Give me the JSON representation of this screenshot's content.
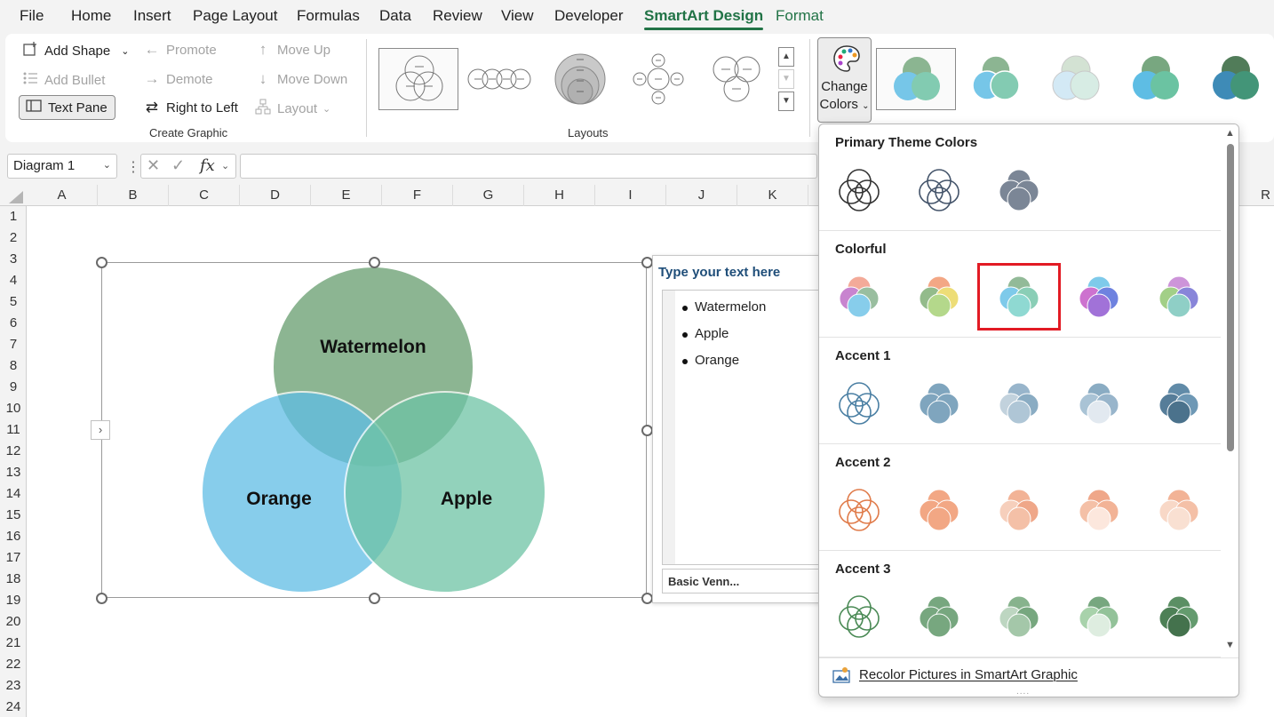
{
  "menu": [
    "File",
    "Home",
    "Insert",
    "Page Layout",
    "Formulas",
    "Data",
    "Review",
    "View",
    "Developer",
    "SmartArt Design",
    "Format"
  ],
  "create_graphic": {
    "add_shape": "Add Shape",
    "add_bullet": "Add Bullet",
    "text_pane": "Text Pane",
    "promote": "Promote",
    "demote": "Demote",
    "right_to_left": "Right to Left",
    "move_up": "Move Up",
    "move_down": "Move Down",
    "layout": "Layout",
    "group_label": "Create Graphic"
  },
  "layouts": {
    "group_label": "Layouts"
  },
  "change_colors": {
    "line1": "Change",
    "line2": "Colors"
  },
  "formula_bar": {
    "name_box": "Diagram 1",
    "fx": "fx",
    "formula": ""
  },
  "columns": [
    "A",
    "B",
    "C",
    "D",
    "E",
    "F",
    "G",
    "H",
    "I",
    "J",
    "K",
    "R"
  ],
  "rows": [
    "1",
    "2",
    "3",
    "4",
    "5",
    "6",
    "7",
    "8",
    "9",
    "10",
    "11",
    "12",
    "13",
    "14",
    "15",
    "16",
    "17",
    "18",
    "19",
    "20",
    "21",
    "22",
    "23",
    "24"
  ],
  "venn": {
    "top": "Watermelon",
    "left": "Orange",
    "right": "Apple",
    "colors": {
      "top": "#78a97f",
      "left": "#5fbde5",
      "right": "#6ec3a5"
    }
  },
  "text_pane": {
    "title": "Type your text here",
    "items": [
      "Watermelon",
      "Apple",
      "Orange"
    ],
    "footer": "Basic Venn..."
  },
  "color_menu": {
    "sections": [
      {
        "title": "Primary Theme Colors"
      },
      {
        "title": "Colorful"
      },
      {
        "title": "Accent 1"
      },
      {
        "title": "Accent 2"
      },
      {
        "title": "Accent 3"
      }
    ],
    "selected": "Colorful 3",
    "recolor": "Recolor Pictures in SmartArt Graphic"
  }
}
